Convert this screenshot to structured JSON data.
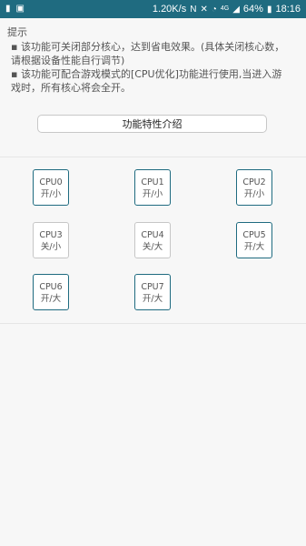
{
  "status_bar": {
    "speed": "1.20K/s",
    "network_label": "4G",
    "battery": "64%",
    "time": "18:16",
    "icons": [
      "notification-icon",
      "image-icon",
      "nfc-icon",
      "mute-icon",
      "wifi-icon",
      "signal-icon",
      "battery-icon"
    ]
  },
  "tips": {
    "title": "提示",
    "lines": [
      "▪ 该功能可关闭部分核心，达到省电效果。(具体关闭核心数，",
      "请根据设备性能自行调节)",
      "▪ 该功能可配合游戏模式的[CPU优化]功能进行使用,当进入游",
      "戏时，所有核心将会全开。"
    ]
  },
  "feature_button": {
    "label": "功能特性介绍"
  },
  "cpus": [
    {
      "name": "CPU0",
      "state": "开/小",
      "on": true
    },
    {
      "name": "CPU1",
      "state": "开/小",
      "on": true
    },
    {
      "name": "CPU2",
      "state": "开/小",
      "on": true
    },
    {
      "name": "CPU3",
      "state": "关/小",
      "on": false
    },
    {
      "name": "CPU4",
      "state": "关/大",
      "on": false
    },
    {
      "name": "CPU5",
      "state": "开/大",
      "on": true
    },
    {
      "name": "CPU6",
      "state": "开/大",
      "on": true
    },
    {
      "name": "CPU7",
      "state": "开/大",
      "on": true
    }
  ],
  "colors": {
    "accent": "#1f6b80",
    "off_border": "#c6c6c6"
  }
}
